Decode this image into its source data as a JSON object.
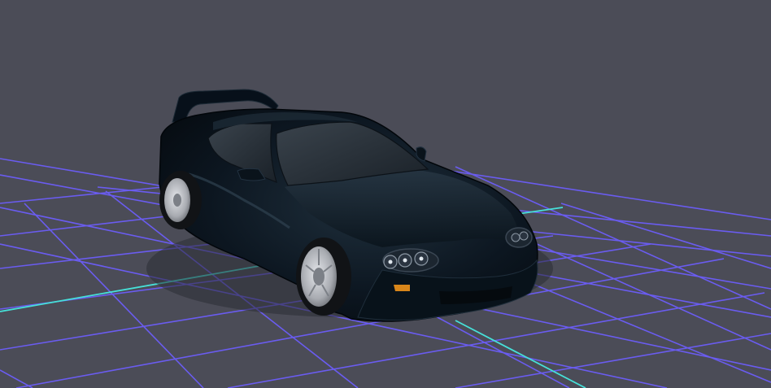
{
  "viewport": {
    "background_color": "#4b4c57",
    "grid_color": "#6a5cf0",
    "axis_x_color": "#46e0d8",
    "axis_z_color": "#46e0d8"
  },
  "model": {
    "name": "sports-coupe",
    "body_color": "#0b1520",
    "body_highlight_color": "#2a3a48",
    "wheel_color": "#b9bcc2",
    "tire_color": "#151515",
    "headlight_color": "#3a4653",
    "indicator_color": "#d8861a",
    "glass_color": "#29323a"
  }
}
